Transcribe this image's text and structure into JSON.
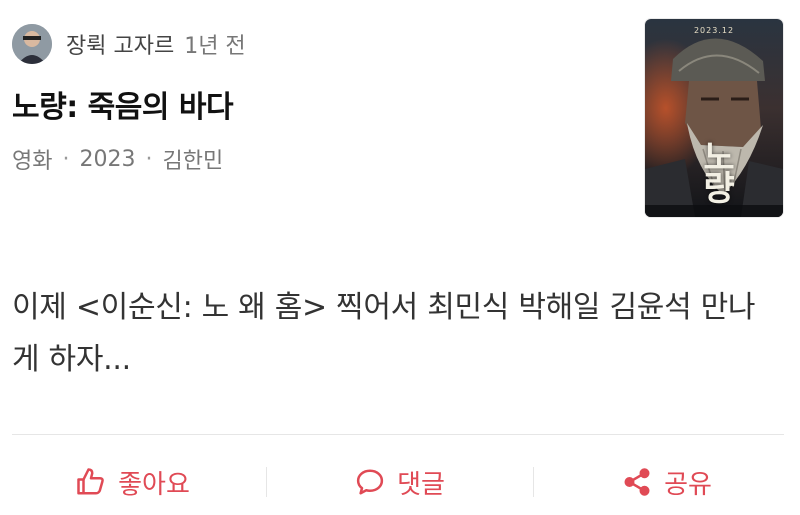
{
  "header": {
    "author": "장뤽 고자르",
    "time": "1년 전",
    "avatar_icon": "user-avatar"
  },
  "post": {
    "title": "노량: 죽음의 바다",
    "category": "영화",
    "year": "2023",
    "director": "김한민",
    "text": "이제 <이순신: 노 왜 홈> 찍어서 최민식 박해일 김윤석 만나게 하자..."
  },
  "poster": {
    "date": "2023.12",
    "title_line1": "노",
    "title_line2": "량"
  },
  "actions": {
    "like_label": "좋아요",
    "comment_label": "댓글",
    "share_label": "공유",
    "accent_color": "#e04a55"
  }
}
